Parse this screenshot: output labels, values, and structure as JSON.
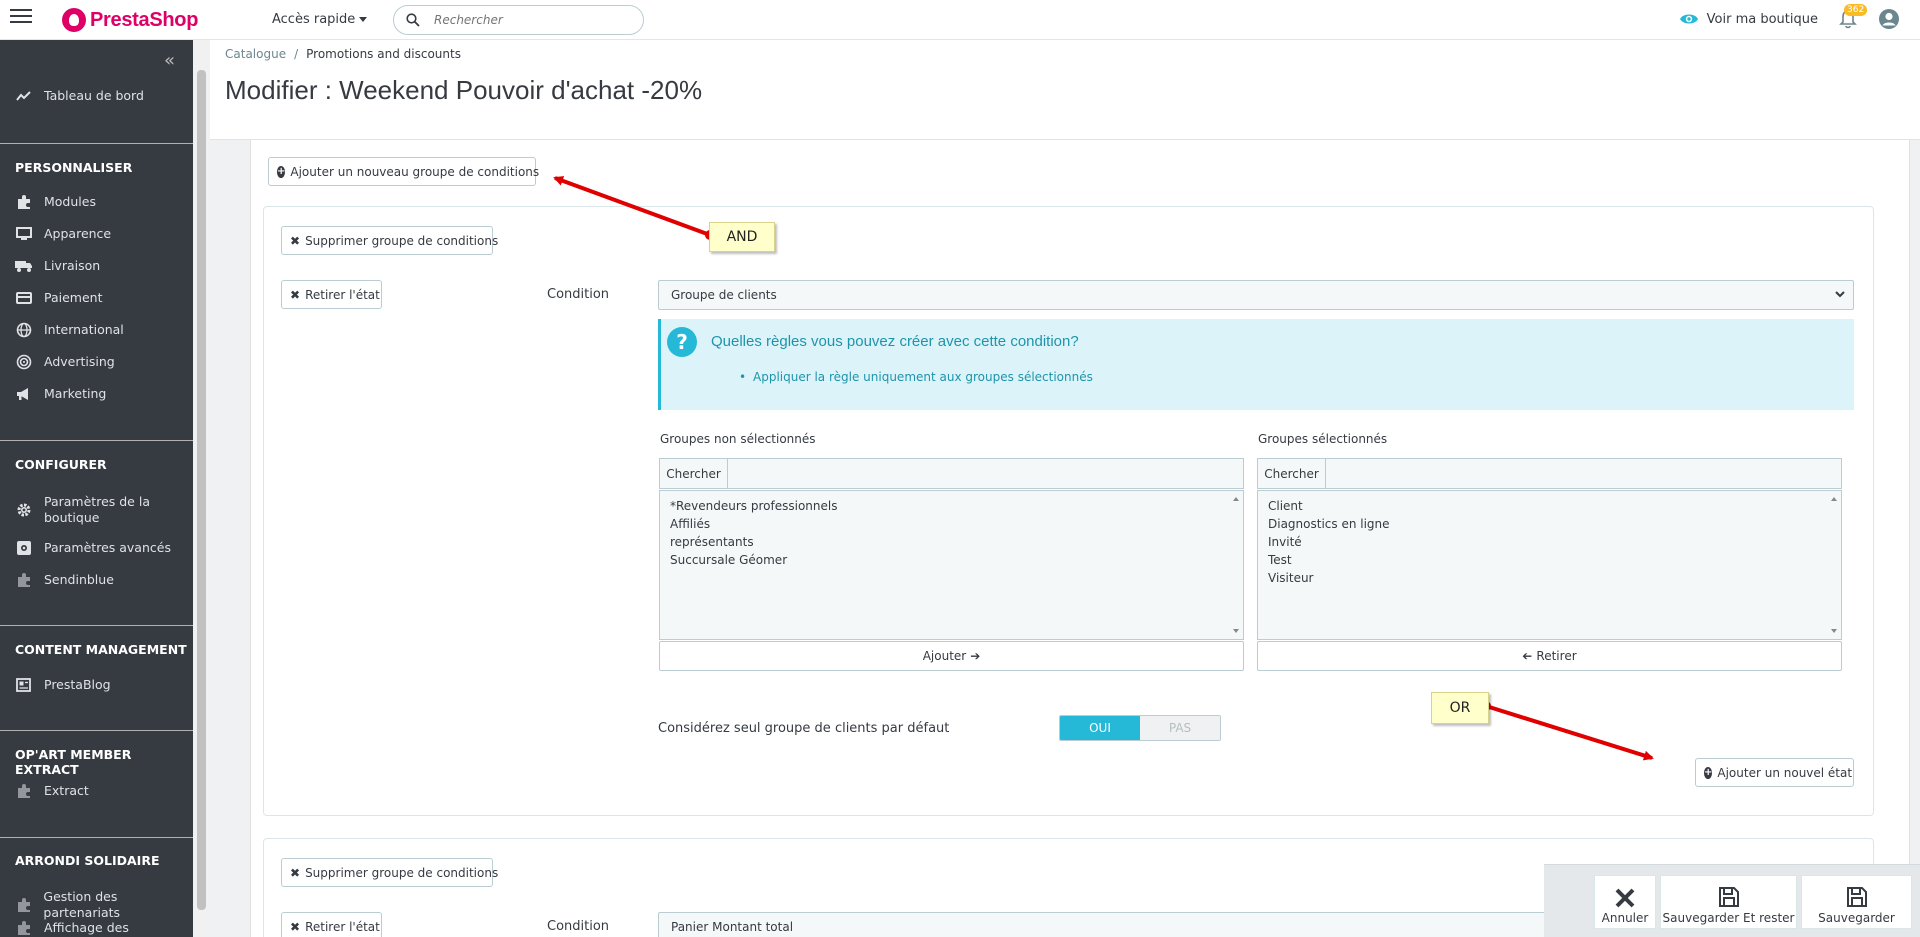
{
  "header": {
    "brand": "PrestaShop",
    "quick_access": "Accès rapide",
    "search_placeholder": "Rechercher",
    "view_shop": "Voir ma boutique",
    "notifications_count": "362"
  },
  "sidebar": {
    "dashboard": "Tableau de bord",
    "sections": [
      {
        "title": "PERSONNALISER",
        "items": [
          "Modules",
          "Apparence",
          "Livraison",
          "Paiement",
          "International",
          "Advertising",
          "Marketing"
        ]
      },
      {
        "title": "CONFIGURER",
        "items": [
          "Paramètres de la boutique",
          "Paramètres avancés",
          "Sendinblue"
        ]
      },
      {
        "title": "CONTENT MANAGEMENT",
        "items": [
          "PrestaBlog"
        ]
      },
      {
        "title": "OP'ART MEMBER EXTRACT",
        "items": [
          "Extract"
        ]
      },
      {
        "title": "ARRONDI SOLIDAIRE",
        "items": [
          "Gestion des partenariats",
          "Affichage des"
        ]
      }
    ]
  },
  "breadcrumb": {
    "parent": "Catalogue",
    "current": "Promotions and discounts"
  },
  "page_title": "Modifier : Weekend Pouvoir d'achat -20%",
  "conditions": {
    "add_group_button": "Ajouter un nouveau groupe de conditions",
    "delete_group_button": "Supprimer groupe de conditions",
    "remove_condition_button": "Retirer l'état",
    "condition_label": "Condition",
    "condition_value": "Groupe de clients",
    "help_title": "Quelles règles vous pouvez créer avec cette condition?",
    "help_item": "Appliquer la règle uniquement aux groupes sélectionnés",
    "unselected_label": "Groupes non sélectionnés",
    "selected_label": "Groupes sélectionnés",
    "search_addon": "Chercher",
    "unselected_groups": [
      "*Revendeurs professionnels",
      "Affiliés",
      "représentants",
      "Succursale Géomer"
    ],
    "selected_groups": [
      "Client",
      "Diagnostics en ligne",
      "Invité",
      "Test",
      "Visiteur"
    ],
    "add_button": "Ajouter",
    "remove_button": "Retirer",
    "default_group_label": "Considérez seul groupe de clients par défaut",
    "toggle_yes": "OUI",
    "toggle_no": "PAS",
    "add_condition_button": "Ajouter un nouvel état",
    "second_condition_value": "Panier Montant total"
  },
  "annotations": {
    "and_label": "AND",
    "or_label": "OR",
    "arrow_color": "#e00000"
  },
  "footer": {
    "cancel": "Annuler",
    "save_stay": "Sauvegarder Et rester",
    "save": "Sauvegarder"
  },
  "colors": {
    "brand": "#df0067",
    "accent": "#25b9d7",
    "sidebar": "#363a41"
  }
}
